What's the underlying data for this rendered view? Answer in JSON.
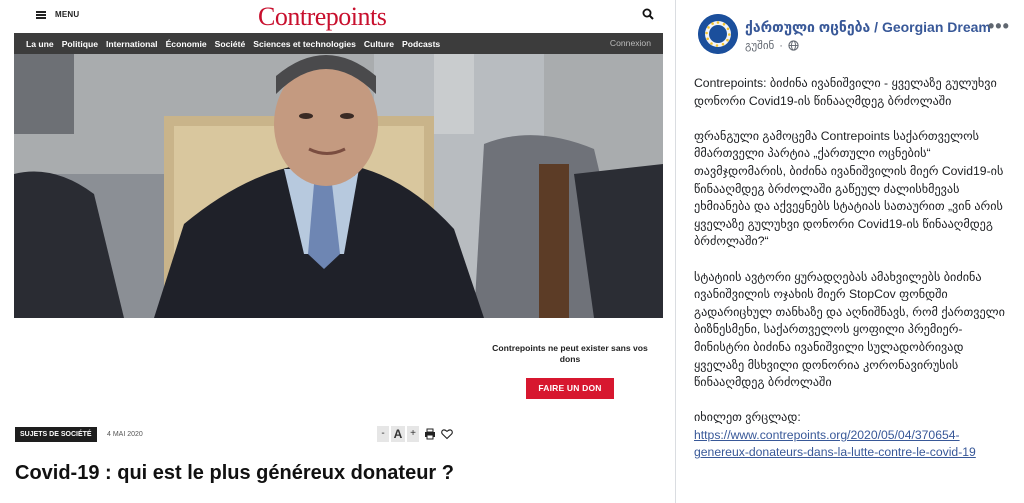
{
  "article": {
    "menu_label": "MENU",
    "logo_text": "Contrepoints",
    "nav_items": [
      "La une",
      "Politique",
      "International",
      "Économie",
      "Société",
      "Sciences et technologies",
      "Culture",
      "Podcasts"
    ],
    "login_label": "Connexion",
    "donate_text": "Contrepoints ne peut exister sans vos dons",
    "donate_button": "FAIRE UN DON",
    "tag": "SUJETS DE SOCIÉTÉ",
    "date": "4 MAI 2020",
    "font_minus": "-",
    "font_a": "A",
    "font_plus": "+",
    "headline": "Covid-19 : qui est le plus généreux donateur ?"
  },
  "post": {
    "page_name": "ქართული ოცნება / Georgian Dream",
    "time": "გუშინ",
    "more_label": "•••",
    "paragraphs": [
      "Contrepoints: ბიძინა ივანიშვილი - ყველაზე გულუხვი დონორი Covid19-ის წინააღმდეგ ბრძოლაში",
      "ფრანგული გამოცემა Contrepoints საქართველოს მმართველი პარტია „ქართული ოცნების“ თავმჯდომარის, ბიძინა ივანიშვილის მიერ Covid19-ის წინააღმდეგ ბრძოლაში გაწეულ ძალისხმევას ეხმიანება და აქვეყნებს სტატიას სათაურით „ვინ არის ყველაზე გულუხვი დონორი Covid19-ის წინააღმდეგ ბრძოლაში?“",
      "სტატიის ავტორი ყურადღებას ამახვილებს ბიძინა ივანიშვილის ოჯახის მიერ StopCov ფონდში გადარიცხულ თანხაზე და აღნიშნავს, რომ ქართველი ბიზნესმენი, საქართველოს ყოფილი პრემიერ-მინისტრი ბიძინა ივანიშვილი სულადობრივად ყველაზე მსხვილი დონორია კორონავირუსის წინააღმდეგ ბრძოლაში"
    ],
    "link_prefix": "იხილეთ ვრცლად:",
    "link_url": "https://www.contrepoints.org/2020/05/04/370654-genereux-donateurs-dans-la-lutte-contre-le-covid-19"
  },
  "colors": {
    "logo_red": "#c8102e",
    "donate_red": "#d7172f",
    "nav_bg": "#3c3c3c",
    "fb_link": "#385898"
  }
}
